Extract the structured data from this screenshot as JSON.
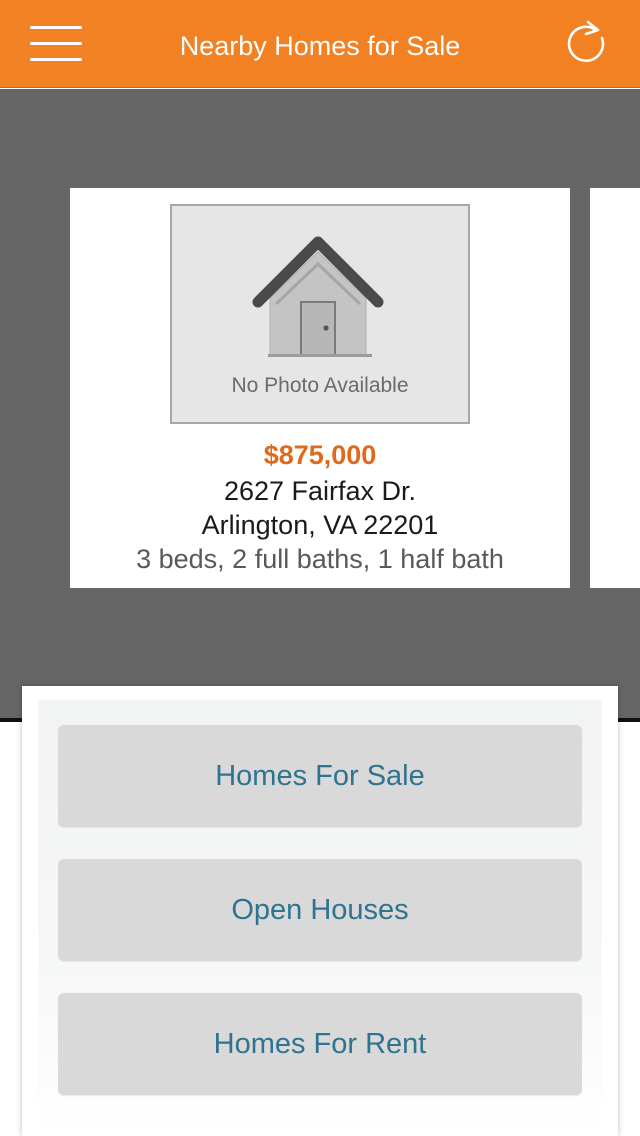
{
  "header": {
    "title": "Nearby Homes for Sale",
    "menu_icon": "hamburger-menu-icon",
    "refresh_icon": "refresh-icon",
    "background_color": "#f28123"
  },
  "listing": {
    "photo_placeholder": "No Photo Available",
    "placeholder_icon": "house-icon",
    "price": "$875,000",
    "address_line1": "2627 Fairfax Dr.",
    "address_line2": "Arlington, VA 22201",
    "details": "3 beds, 2 full baths, 1 half bath",
    "price_color": "#e0691a"
  },
  "menu": {
    "buttons": [
      {
        "label": "Homes For Sale"
      },
      {
        "label": "Open Houses"
      },
      {
        "label": "Homes For Rent"
      }
    ],
    "label_color": "#2e7490"
  }
}
